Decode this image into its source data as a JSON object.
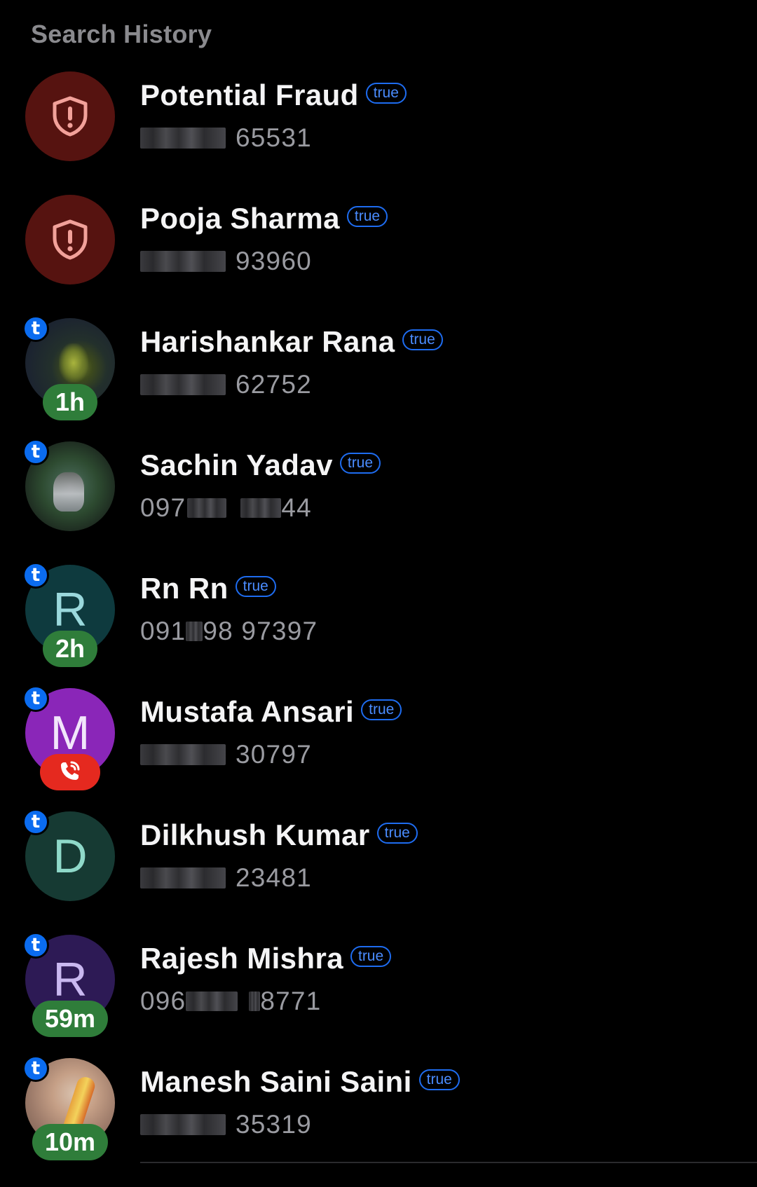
{
  "section_title": "Search History",
  "items": [
    {
      "name": "Potential Fraud",
      "tag": "true",
      "number_visible": "65531",
      "avatar": {
        "type": "fraud",
        "icon": "shield-alert-icon"
      }
    },
    {
      "name": "Pooja Sharma",
      "tag": "true",
      "number_visible": "93960",
      "avatar": {
        "type": "fraud",
        "icon": "shield-alert-icon"
      }
    },
    {
      "name": "Harishankar Rana",
      "tag": "true",
      "number_visible": "62752",
      "avatar": {
        "type": "photo",
        "badge": "t",
        "time": "1h"
      }
    },
    {
      "name": "Sachin Yadav",
      "tag": "true",
      "number_prefix": "097",
      "number_suffix": "44",
      "avatar": {
        "type": "photo",
        "badge": "t"
      }
    },
    {
      "name": "Rn Rn",
      "tag": "true",
      "number_prefix": "091",
      "number_suffix": "98 97397",
      "avatar": {
        "type": "letter",
        "letter": "R",
        "badge": "t",
        "time": "2h"
      }
    },
    {
      "name": "Mustafa Ansari",
      "tag": "true",
      "number_visible": "30797",
      "avatar": {
        "type": "letter",
        "letter": "M",
        "badge": "t",
        "call_icon": "phone-ringing-icon"
      }
    },
    {
      "name": "Dilkhush Kumar",
      "tag": "true",
      "number_visible": "23481",
      "avatar": {
        "type": "letter",
        "letter": "D",
        "badge": "t"
      }
    },
    {
      "name": "Rajesh Mishra",
      "tag": "true",
      "number_prefix": "096",
      "number_suffix": "8771",
      "avatar": {
        "type": "letter",
        "letter": "R",
        "badge": "t",
        "time": "59m"
      }
    },
    {
      "name": "Manesh Saini Saini",
      "tag": "true",
      "number_visible": "35319",
      "avatar": {
        "type": "photo",
        "badge": "t",
        "time": "10m"
      }
    }
  ],
  "colors": {
    "background": "#000000",
    "title_gray": "#8a8a8e",
    "true_tag_blue": "#1e6cf0",
    "fraud_red": "#561310",
    "time_green": "#2f7d3a",
    "call_red": "#e5291f"
  }
}
